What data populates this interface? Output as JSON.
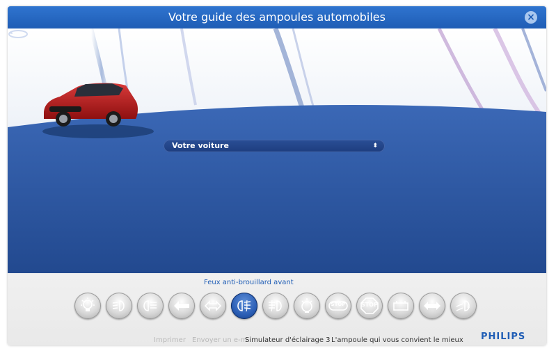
{
  "window": {
    "title": "Votre guide des ampoules automobiles",
    "close_symbol": "×"
  },
  "selector": {
    "label": "Votre voiture",
    "arrows": "⬍"
  },
  "functions": {
    "current_label": "Feux anti-brouillard avant",
    "buttons": [
      {
        "name": "interior-light-icon",
        "active": false
      },
      {
        "name": "low-beam-icon",
        "active": false
      },
      {
        "name": "high-beam-icon",
        "active": false
      },
      {
        "name": "turn-signal-front-icon",
        "active": false
      },
      {
        "name": "side-indicator-icon",
        "active": false
      },
      {
        "name": "front-fog-light-icon",
        "active": true
      },
      {
        "name": "rear-fog-light-icon",
        "active": false
      },
      {
        "name": "license-plate-light-icon",
        "active": false
      },
      {
        "name": "brake-light-icon",
        "active": false
      },
      {
        "name": "stop-light-icon",
        "active": false
      },
      {
        "name": "parking-light-icon",
        "active": false
      },
      {
        "name": "turn-signal-rear-icon",
        "active": false
      },
      {
        "name": "reverse-light-icon",
        "active": false
      }
    ],
    "stop_text": "STOP"
  },
  "footer": {
    "print": "Imprimer",
    "email": "Envoyer un e-m",
    "simulator": "Simulateur d'éclairage 3",
    "best_bulb": "L'ampoule qui vous convient le mieux"
  },
  "brand": {
    "name": "PHILIPS"
  },
  "colors": {
    "accent": "#1f5db5",
    "stage_blue": "#2a55a3"
  }
}
